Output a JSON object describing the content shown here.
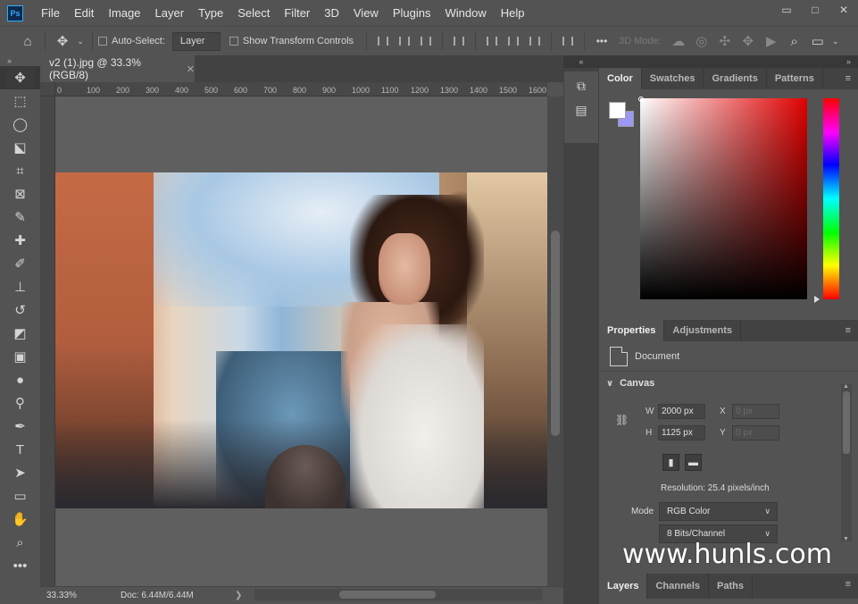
{
  "app": {
    "logo": "Ps",
    "logo_color": "#31a8ff"
  },
  "menu": [
    "File",
    "Edit",
    "Image",
    "Layer",
    "Type",
    "Select",
    "Filter",
    "3D",
    "View",
    "Plugins",
    "Window",
    "Help"
  ],
  "window_controls": {
    "minimize": "▭",
    "restore": "□",
    "close": "✕"
  },
  "options": {
    "auto_select_label": "Auto-Select:",
    "auto_select_value": "Layer",
    "transform_label": "Show Transform Controls",
    "more": "•••",
    "mode_3d": "3D Mode:"
  },
  "document": {
    "tab_title": "v2 (1).jpg @ 33.3% (RGB/8)",
    "tab_close": "✕"
  },
  "ruler": {
    "top_ticks": [
      "0",
      "100",
      "200",
      "300",
      "400",
      "500",
      "600",
      "700",
      "800",
      "900",
      "1000",
      "1100",
      "1200",
      "1300",
      "1400",
      "1500",
      "1600"
    ]
  },
  "status": {
    "zoom": "33.33%",
    "doc_size": "Doc: 6.44M/6.44M",
    "arrow": "❯",
    "scroll_left": "‹",
    "scroll_right": "›"
  },
  "color_panel": {
    "tabs": [
      "Color",
      "Swatches",
      "Gradients",
      "Patterns"
    ],
    "foreground": "#ffffff",
    "background": "#9b98f4",
    "hue_base": "#e00000"
  },
  "properties_panel": {
    "tabs": [
      "Properties",
      "Adjustments"
    ],
    "document_label": "Document",
    "canvas_section": "Canvas",
    "width_label": "W",
    "width_value": "2000 px",
    "height_label": "H",
    "height_value": "1125 px",
    "x_label": "X",
    "x_placeholder": "0 px",
    "y_label": "Y",
    "y_placeholder": "0 px",
    "resolution": "Resolution: 25.4 pixels/inch",
    "mode_label": "Mode",
    "mode_value": "RGB Color",
    "bits_value": "8 Bits/Channel"
  },
  "layers_panel": {
    "tabs": [
      "Layers",
      "Channels",
      "Paths"
    ]
  },
  "panel_menu_icon": "≡",
  "collapse": "»",
  "collapse_left": "«",
  "watermark": "www.hunls.com"
}
